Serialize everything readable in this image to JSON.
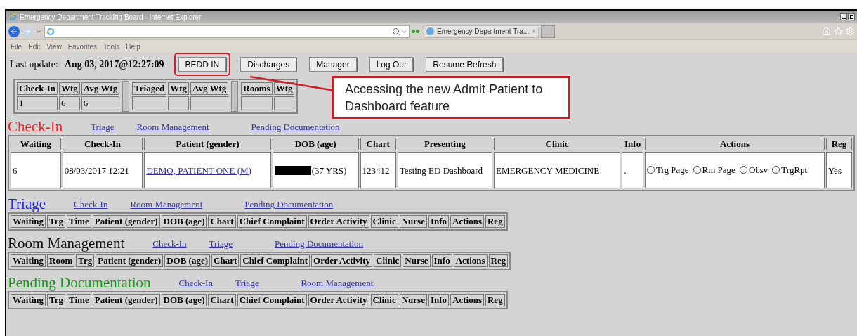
{
  "window": {
    "title": "Emergency Department Tracking Board - Internet Explorer"
  },
  "browser": {
    "tab_title": "Emergency Department Tra...",
    "tab_close": "×",
    "menu": [
      "File",
      "Edit",
      "View",
      "Favorites",
      "Tools",
      "Help"
    ]
  },
  "toolbar": {
    "label": "Last update:",
    "timestamp": "Aug 03, 2017@12:27:09",
    "buttons": [
      {
        "label": "BEDD IN",
        "highlighted": true
      },
      {
        "label": "Discharges",
        "highlighted": false
      },
      {
        "label": "Manager",
        "highlighted": false
      },
      {
        "label": "Log Out",
        "highlighted": false
      },
      {
        "label": "Resume Refresh",
        "highlighted": false
      }
    ]
  },
  "callout": {
    "text": "Accessing the new Admit Patient to Dashboard feature"
  },
  "summary": {
    "groups": [
      {
        "columns": [
          "Check-In",
          "Wtg",
          "Avg Wtg"
        ],
        "values": [
          "1",
          "6",
          "6"
        ]
      },
      {
        "columns": [
          "Triaged",
          "Wtg",
          "Avg Wtg"
        ]
      },
      {
        "columns": [
          "Rooms",
          "Wtg"
        ]
      }
    ]
  },
  "sections": [
    {
      "title": "Check-In",
      "color": "#ee2222",
      "links": [
        "Triage",
        "Room Management",
        "Pending Documentation"
      ],
      "columns": [
        "Waiting",
        "Check-In",
        "Patient (gender)",
        "DOB (age)",
        "Chart",
        "Presenting",
        "Clinic",
        "Info",
        "Actions",
        "Reg"
      ],
      "rows": [
        [
          {
            "kind": "text",
            "text": "6"
          },
          {
            "kind": "text",
            "text": "08/03/2017 12:21"
          },
          {
            "kind": "link",
            "text": "DEMO, PATIENT ONE (M)"
          },
          {
            "kind": "redacted",
            "text": "(37 YRS)"
          },
          {
            "kind": "text",
            "text": "123412"
          },
          {
            "kind": "text",
            "text": "Testing ED Dashboard"
          },
          {
            "kind": "text",
            "text": "EMERGENCY MEDICINE"
          },
          {
            "kind": "text",
            "text": "."
          },
          {
            "kind": "radios",
            "options": [
              {
                "label": "Trg Page",
                "selected": false
              },
              {
                "label": "Rm Page",
                "selected": false
              },
              {
                "label": "Obsv",
                "selected": false
              },
              {
                "label": "TrgRpt",
                "selected": false
              }
            ]
          },
          {
            "kind": "text",
            "text": "Yes"
          }
        ]
      ]
    },
    {
      "title": "Triage",
      "color": "#2222ee",
      "links": [
        "Check-In",
        "Room Management",
        "Pending Documentation"
      ],
      "columns": [
        "Waiting",
        "Trg",
        "Time",
        "Patient (gender)",
        "DOB (age)",
        "Chart",
        "Chief Complaint",
        "Order Activity",
        "Clinic",
        "Nurse",
        "Info",
        "Actions",
        "Reg"
      ]
    },
    {
      "title": "Room Management",
      "color": "#111111",
      "links": [
        "Check-In",
        "Triage",
        "Pending Documentation"
      ],
      "columns": [
        "Waiting",
        "Room",
        "Trg",
        "Patient (gender)",
        "DOB (age)",
        "Chart",
        "Chief Complaint",
        "Order Activity",
        "Clinic",
        "Nurse",
        "Info",
        "Actions",
        "Reg"
      ]
    },
    {
      "title": "Pending Documentation",
      "color": "#1a9a1a",
      "links": [
        "Check-In",
        "Triage",
        "Room Management"
      ],
      "columns": [
        "Waiting",
        "Trg",
        "Time",
        "Patient (gender)",
        "DOB (age)",
        "Chart",
        "Chief Complaint",
        "Order Activity",
        "Clinic",
        "Nurse",
        "Info",
        "Actions",
        "Reg"
      ]
    }
  ]
}
